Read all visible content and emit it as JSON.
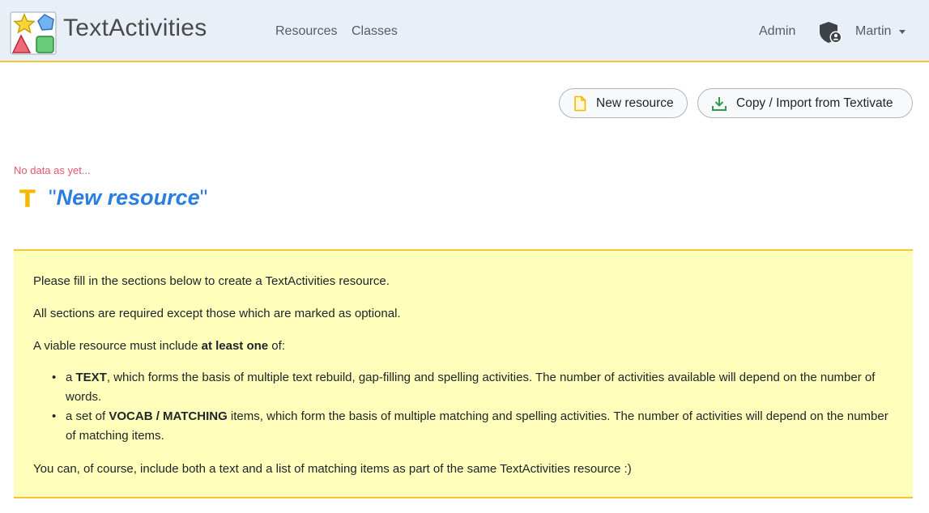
{
  "header": {
    "brand": "TextActivities",
    "nav": {
      "resources": "Resources",
      "classes": "Classes"
    },
    "admin": "Admin",
    "user": "Martin",
    "icons": [
      "logo-icon",
      "shield-user-icon",
      "caret-down-icon"
    ]
  },
  "toolbar": {
    "new_resource": "New resource",
    "copy_import": "Copy / Import from Textivate"
  },
  "status": "No data as yet...",
  "resource": {
    "prefix_icon": "T",
    "open_quote": "\"",
    "name": "New resource",
    "close_quote": "\""
  },
  "info": {
    "line1": "Please fill in the sections below to create a TextActivities resource.",
    "line2": "All sections are required except those which are marked as optional.",
    "line3_pre": "A viable resource must include ",
    "line3_bold": "at least one",
    "line3_post": " of:",
    "bullet1_pre": "a ",
    "bullet1_bold": "TEXT",
    "bullet1_post": ", which forms the basis of multiple text rebuild, gap-filling and spelling activities. The number of activities available will depend on the number of words.",
    "bullet2_pre": "a set of ",
    "bullet2_bold": "VOCAB / MATCHING",
    "bullet2_post": " items, which form the basis of multiple matching and spelling activities. The number of activities will depend on the number of matching items.",
    "line4": "You can, of course, include both a text and a list of matching items as part of the same TextActivities resource :)"
  },
  "colors": {
    "navbar_bg": "#e9eff7",
    "accent_border": "#f5c338",
    "title_blue": "#2a7ee0",
    "status_red": "#e8556c",
    "info_bg": "#ffffbb"
  }
}
